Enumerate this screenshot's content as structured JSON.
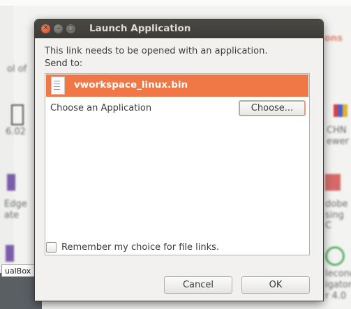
{
  "background": {
    "fragments": [
      "ons",
      "ol of",
      "6.02",
      "CHN",
      "ewer",
      "Edge",
      "ate",
      "dobe",
      "sing C",
      "lecond",
      "igator",
      "r 4.0"
    ],
    "tooltip": "ualBox"
  },
  "dialog": {
    "title": "Launch Application",
    "message": "This link needs to be opened with an application.",
    "send_to": "Send to:",
    "selected_item": "vworkspace_linux.bin",
    "choose_label": "Choose an Application",
    "choose_button": "Choose...",
    "remember_label": "Remember my choice for file links.",
    "remember_checked": false,
    "cancel_button": "Cancel",
    "ok_button": "OK"
  },
  "colors": {
    "accent": "#f07746",
    "titlebar": "#3c3b37"
  }
}
